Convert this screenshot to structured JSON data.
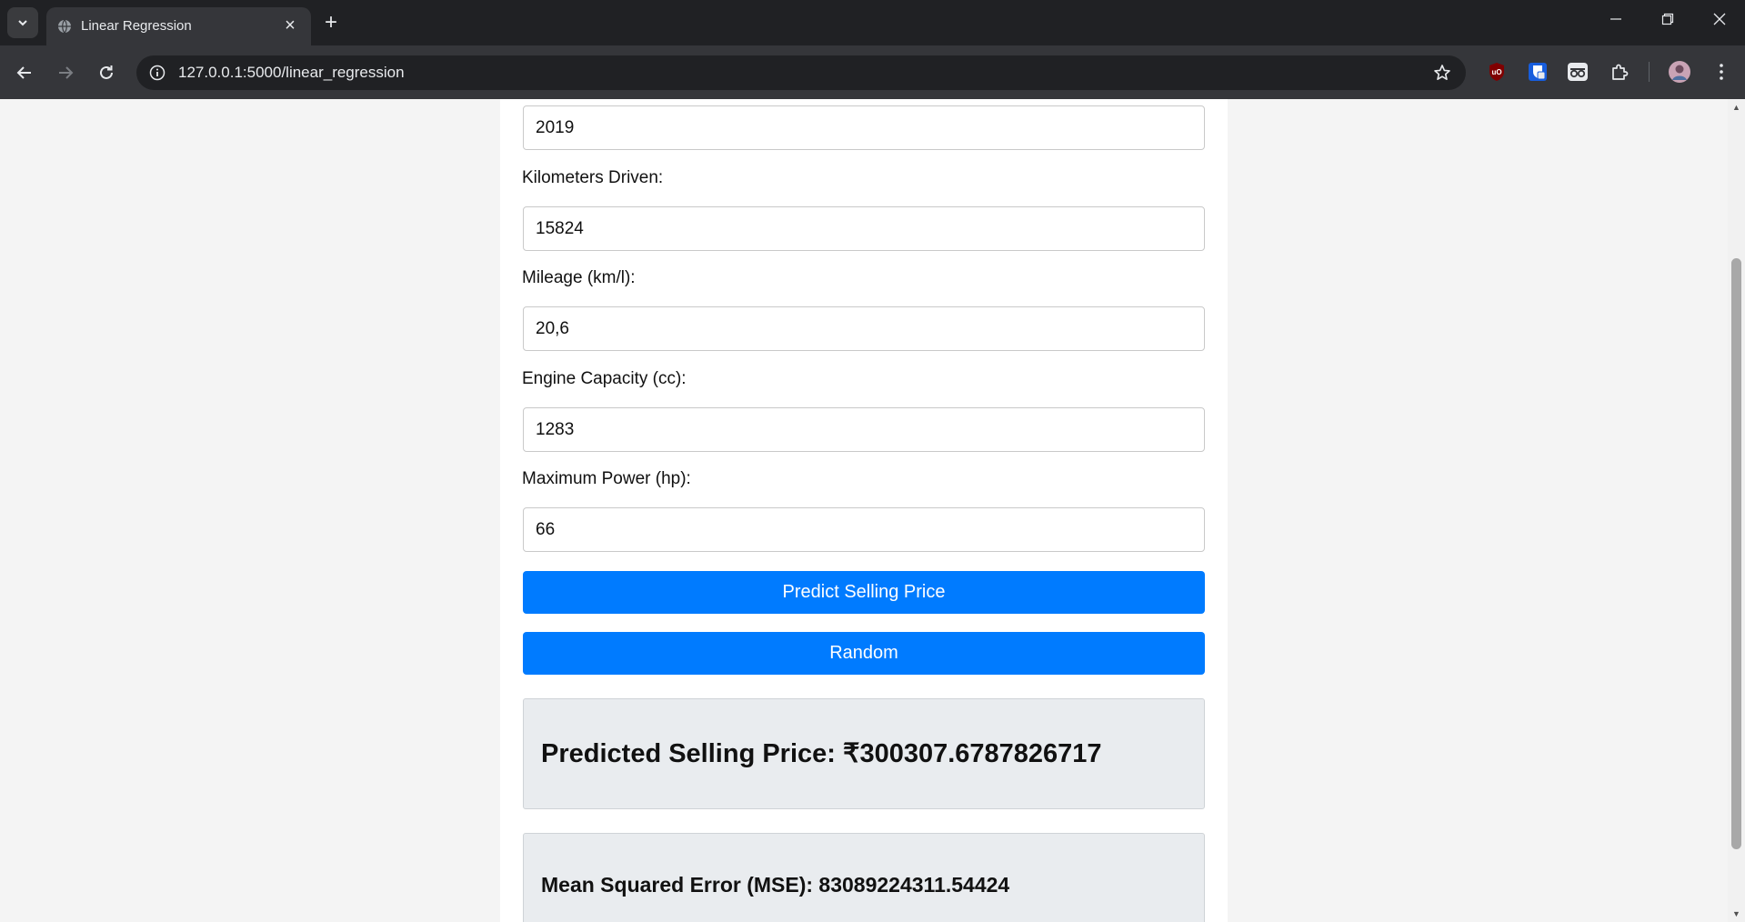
{
  "browser": {
    "tab_title": "Linear Regression",
    "url": "127.0.0.1:5000/linear_regression",
    "new_tab_symbol": "+",
    "close_symbol": "✕",
    "icons": {
      "tab_search": "chevron-down-icon",
      "back": "arrow-left-icon",
      "forward": "arrow-right-icon",
      "reload": "reload-icon",
      "site_info": "info-icon",
      "bookmark": "star-icon",
      "extensions": [
        "ublock-icon",
        "bitwarden-icon",
        "incognito-glasses-icon",
        "puzzle-piece-icon"
      ],
      "profile": "avatar",
      "menu": "kebab-menu-icon"
    },
    "colors": {
      "tabstrip": "#202124",
      "toolbar": "#35363a",
      "omnibox": "#202124"
    }
  },
  "form": {
    "fields": [
      {
        "label": "",
        "value": "2019"
      },
      {
        "label": "Kilometers Driven:",
        "value": "15824"
      },
      {
        "label": "Mileage (km/l):",
        "value": "20,6"
      },
      {
        "label": "Engine Capacity (cc):",
        "value": "1283"
      },
      {
        "label": "Maximum Power (hp):",
        "value": "66"
      }
    ],
    "predict_button": "Predict Selling Price",
    "random_button": "Random"
  },
  "results": {
    "predicted_price": "Predicted Selling Price: ₹300307.6787826717",
    "mse": "Mean Squared Error (MSE): 83089224311.54424"
  },
  "colors": {
    "button": "#007bff",
    "result_background": "#e9ecef",
    "page_background": "#f4f4f4"
  }
}
